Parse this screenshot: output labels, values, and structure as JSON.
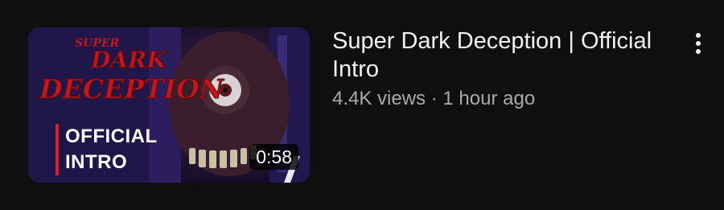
{
  "video": {
    "title": "Super Dark Deception | Official Intro",
    "views": "4.4K views",
    "separator": "·",
    "uploaded": "1 hour ago",
    "duration": "0:58",
    "thumbnail": {
      "logo_lines": [
        "SUPER",
        "DARK",
        "DECEPTION"
      ],
      "overlay_line1": "OFFICIAL",
      "overlay_line2": "INTRO",
      "logo_color": "#c0161e",
      "accent_bar_color": "#d81f26",
      "background_color": "#1a1233"
    }
  },
  "actions": {
    "more_icon": "vertical-ellipsis-icon"
  }
}
